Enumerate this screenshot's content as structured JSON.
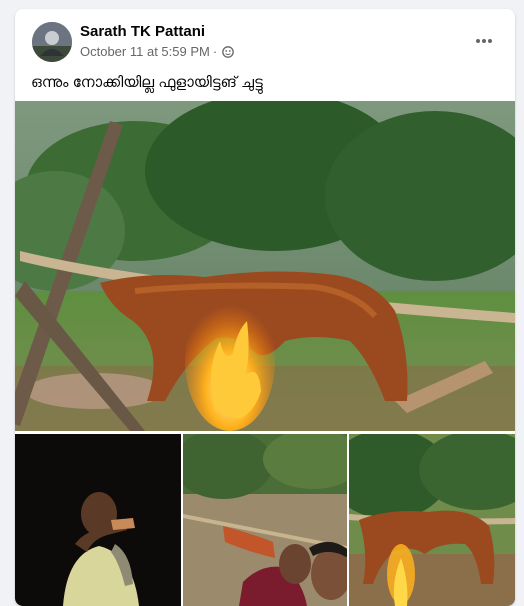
{
  "post": {
    "author": "Sarath TK Pattani",
    "timestamp": "October 11 at 5:59 PM",
    "separator": "·",
    "privacy_icon": "friends-globe-icon",
    "more_icon": "more-horizontal-icon",
    "caption": "ഒന്നും നോക്കിയില്ല ഫുളായിട്ടങ് ചുട്ടു"
  },
  "media": {
    "main": "roasting-animal-on-spit-photo",
    "thumbnails": [
      "man-eating-at-night-photo",
      "spit-roast-selfie-photo",
      "roasting-animal-closeup-photo"
    ]
  },
  "colors": {
    "card_bg": "#ffffff",
    "page_bg": "#f0f2f5",
    "author_text": "#050505",
    "meta_text": "#65676b"
  }
}
